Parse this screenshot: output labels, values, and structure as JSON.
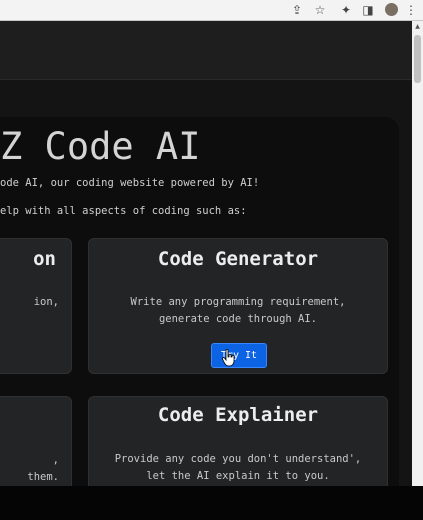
{
  "browser": {
    "toolbar_icons": [
      "share-icon",
      "bookmark-star-icon",
      "extensions-icon",
      "side-panel-icon",
      "profile-avatar-icon",
      "more-menu-icon"
    ]
  },
  "page": {
    "title": "Z Code AI",
    "intro_line1": "ode AI, our coding website powered by AI!",
    "intro_line2": "elp with all aspects of coding such as:"
  },
  "cards": {
    "left_top": {
      "title": "on",
      "text_line1": "ion,"
    },
    "generator": {
      "title": "Code Generator",
      "text_line1": "Write any programming requirement,",
      "text_line2": "generate code through AI.",
      "button_label": "Try It"
    },
    "left_bottom": {
      "text_line1": ",",
      "text_line2": "them."
    },
    "explainer": {
      "title": "Code Explainer",
      "text_line1": "Provide any code you don't understand',",
      "text_line2": "let the AI explain it to you."
    }
  },
  "colors": {
    "page_background": "#141414",
    "card_background": "#222426",
    "button_blue": "#0c63e4",
    "title_text": "#d4d4d4"
  }
}
